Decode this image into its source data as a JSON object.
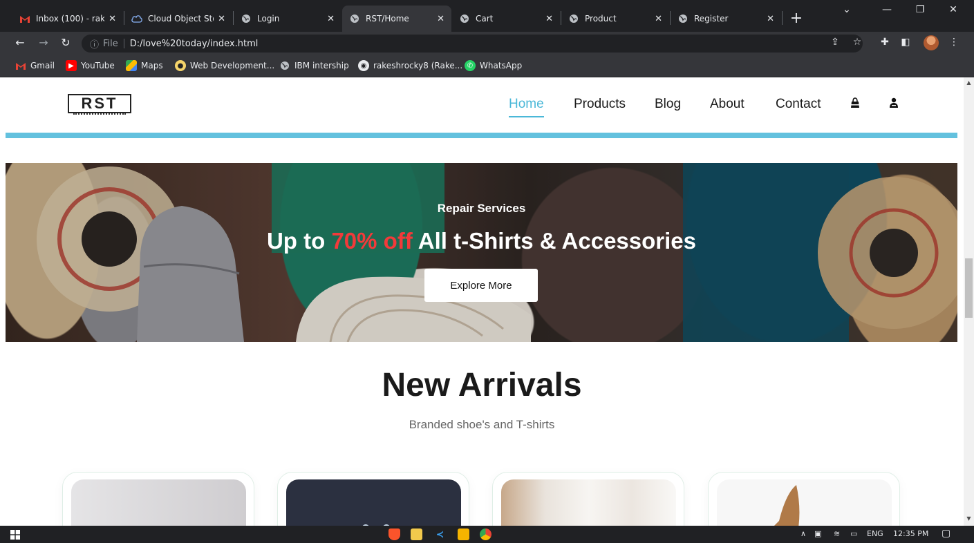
{
  "browser": {
    "tabs": [
      {
        "title": "Inbox (100) - rak",
        "icon": "gmail-icon",
        "active": false
      },
      {
        "title": "Cloud Object Sto",
        "icon": "cloud-icon",
        "active": false
      },
      {
        "title": "Login",
        "icon": "globe-icon",
        "active": false
      },
      {
        "title": "RST/Home",
        "icon": "globe-icon",
        "active": true
      },
      {
        "title": "Cart",
        "icon": "globe-icon",
        "active": false
      },
      {
        "title": "Product",
        "icon": "globe-icon",
        "active": false
      },
      {
        "title": "Register",
        "icon": "globe-icon",
        "active": false
      }
    ],
    "tab_close": "✕",
    "new_tab": "+",
    "address": {
      "scheme_label": "File",
      "url": "D:/love%20today/index.html"
    },
    "bookmarks": [
      {
        "label": "Gmail",
        "icon": "gmail-icon"
      },
      {
        "label": "YouTube",
        "icon": "youtube-icon"
      },
      {
        "label": "Maps",
        "icon": "maps-icon"
      },
      {
        "label": "Web Development...",
        "icon": "bookmark-site-icon"
      },
      {
        "label": "IBM intership",
        "icon": "globe-icon"
      },
      {
        "label": "rakeshrocky8 (Rake...",
        "icon": "github-icon"
      },
      {
        "label": "WhatsApp",
        "icon": "whatsapp-icon"
      }
    ]
  },
  "site": {
    "logo_text": "RST",
    "nav": [
      {
        "label": "Home",
        "active": true
      },
      {
        "label": "Products",
        "active": false
      },
      {
        "label": "Blog",
        "active": false
      },
      {
        "label": "About",
        "active": false
      },
      {
        "label": "Contact",
        "active": false
      }
    ],
    "hero": {
      "subtitle": "Repair Services",
      "title_prefix": "Up to ",
      "title_highlight": "70% off",
      "title_suffix": " All t-Shirts & Accessories",
      "button": "Explore More"
    },
    "arrivals": {
      "title": "New Arrivals",
      "subtitle": "Branded shoe's and T-shirts"
    }
  },
  "taskbar": {
    "language": "ENG",
    "time": "12:35 PM"
  },
  "colors": {
    "accent": "#4bb8d8",
    "divider": "#63c1de",
    "highlight": "#f23a3a"
  }
}
